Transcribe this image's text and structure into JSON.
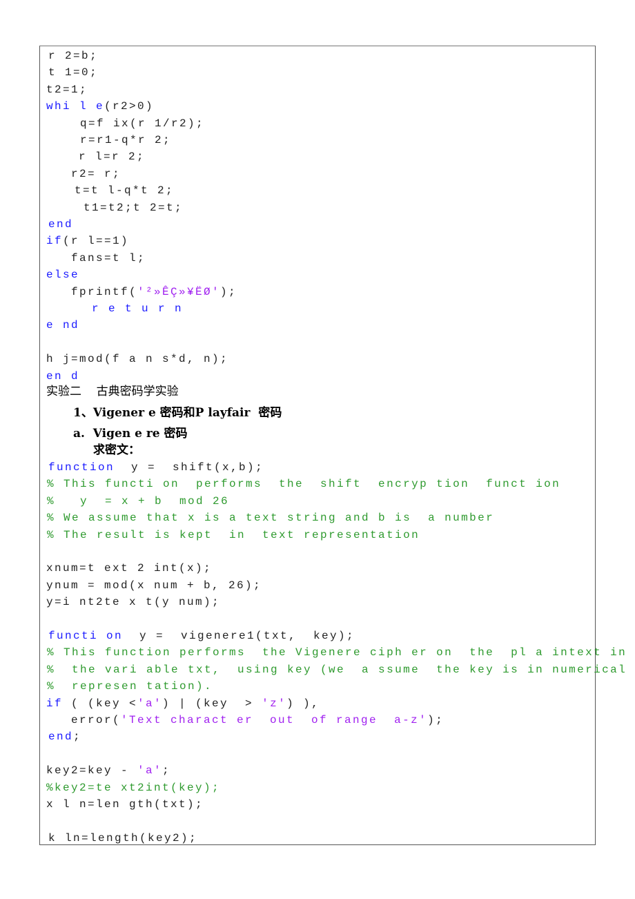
{
  "code_block_1": [
    [
      [
        "tx",
        "r 2=b;"
      ]
    ],
    [
      [
        "tx",
        "t 1=0;"
      ]
    ],
    [
      [
        "tx",
        "t2=1;"
      ]
    ],
    [
      [
        "kw",
        "whi l e"
      ],
      [
        "tx",
        "(r2>0)"
      ]
    ],
    [
      [
        "tx",
        "q=f ix(r 1/r2);"
      ]
    ],
    [
      [
        "tx",
        "r=r1-q*r 2;"
      ]
    ],
    [
      [
        "tx",
        "r l=r 2;"
      ]
    ],
    [
      [
        "tx",
        "r2= r;"
      ]
    ],
    [
      [
        "tx",
        "t=t l-q*t 2;"
      ]
    ],
    [
      [
        "tx",
        "t1=t2;t 2=t;"
      ]
    ],
    [
      [
        "kw",
        "end"
      ]
    ],
    [
      [
        "kw",
        "if"
      ],
      [
        "tx",
        "(r l==1)"
      ]
    ],
    [
      [
        "tx",
        "fans=t l;"
      ]
    ],
    [
      [
        "kw",
        "else"
      ]
    ],
    [
      [
        "tx",
        "fprintf("
      ],
      [
        "str",
        "'²»ÊÇ»¥ËØ'"
      ],
      [
        "tx",
        ");"
      ]
    ],
    [
      [
        "kw",
        "r e t u r n"
      ]
    ],
    [
      [
        "kw",
        "e nd"
      ]
    ],
    [
      [
        "tx",
        ""
      ]
    ],
    [
      [
        "tx",
        "h j=mod(f a n s*d, n);"
      ]
    ],
    [
      [
        "kw",
        "en d"
      ]
    ]
  ],
  "headings": {
    "section": "实验二    古典密码学实验",
    "item1_num": "1、",
    "item1": "Vigener e 密码和P layfair  密码",
    "item_a_num": "a.",
    "item_a": "Vigen e re 密码",
    "sub": "求密文："
  },
  "code_block_2": [
    [
      [
        "kw",
        "function"
      ],
      [
        "tx",
        "  y =  shift(x,b);"
      ]
    ],
    [
      [
        "cm",
        "% This functi on  performs  the  shift  encryp tion  funct ion"
      ]
    ],
    [
      [
        "cm",
        "%   y  = x + b  mod 26"
      ]
    ],
    [
      [
        "cm",
        "% We assume that x is a text string and b is  a number"
      ]
    ],
    [
      [
        "cm",
        "% The result is kept  in  text representation"
      ]
    ],
    [
      [
        "tx",
        ""
      ]
    ],
    [
      [
        "tx",
        "xnum=t ext 2 int(x);"
      ]
    ],
    [
      [
        "tx",
        "ynum = mod(x num + b, 26);"
      ]
    ],
    [
      [
        "tx",
        "y=i nt2te x t(y num);"
      ]
    ],
    [
      [
        "tx",
        ""
      ]
    ],
    [
      [
        "kw",
        "functi on"
      ],
      [
        "tx",
        "  y =  vigenere1(txt,  key);"
      ]
    ],
    [
      [
        "cm",
        "% This function performs  the Vigenere ciph er on  the  pl a intext in"
      ]
    ],
    [
      [
        "cm",
        "%  the vari able txt,  using key (we  a ssume  the key is in numerical"
      ]
    ],
    [
      [
        "cm",
        "%  represen tation)."
      ]
    ],
    [
      [
        "kw",
        "if"
      ],
      [
        "tx",
        " ( (key <"
      ],
      [
        "str",
        "'a'"
      ],
      [
        "tx",
        ") | (key  > "
      ],
      [
        "str",
        "'z'"
      ],
      [
        "tx",
        ") ),"
      ]
    ],
    [
      [
        "tx",
        "error("
      ],
      [
        "str",
        "'Text charact er  out  of range  a-z'"
      ],
      [
        "tx",
        ");"
      ]
    ],
    [
      [
        "kw",
        "end"
      ],
      [
        "tx",
        ";"
      ]
    ],
    [
      [
        "tx",
        ""
      ]
    ],
    [
      [
        "tx",
        "key2=key - "
      ],
      [
        "str",
        "'a'"
      ],
      [
        "tx",
        ";"
      ]
    ],
    [
      [
        "cm",
        "%key2=te xt2int(key);"
      ]
    ],
    [
      [
        "tx",
        "x l n=len gth(txt);"
      ]
    ],
    [
      [
        "tx",
        ""
      ]
    ],
    [
      [
        "tx",
        "k ln=length(key2);"
      ]
    ]
  ],
  "colors": {
    "keyword": "#1a1aff",
    "string": "#a020f0",
    "comment": "#2e9a2e"
  }
}
